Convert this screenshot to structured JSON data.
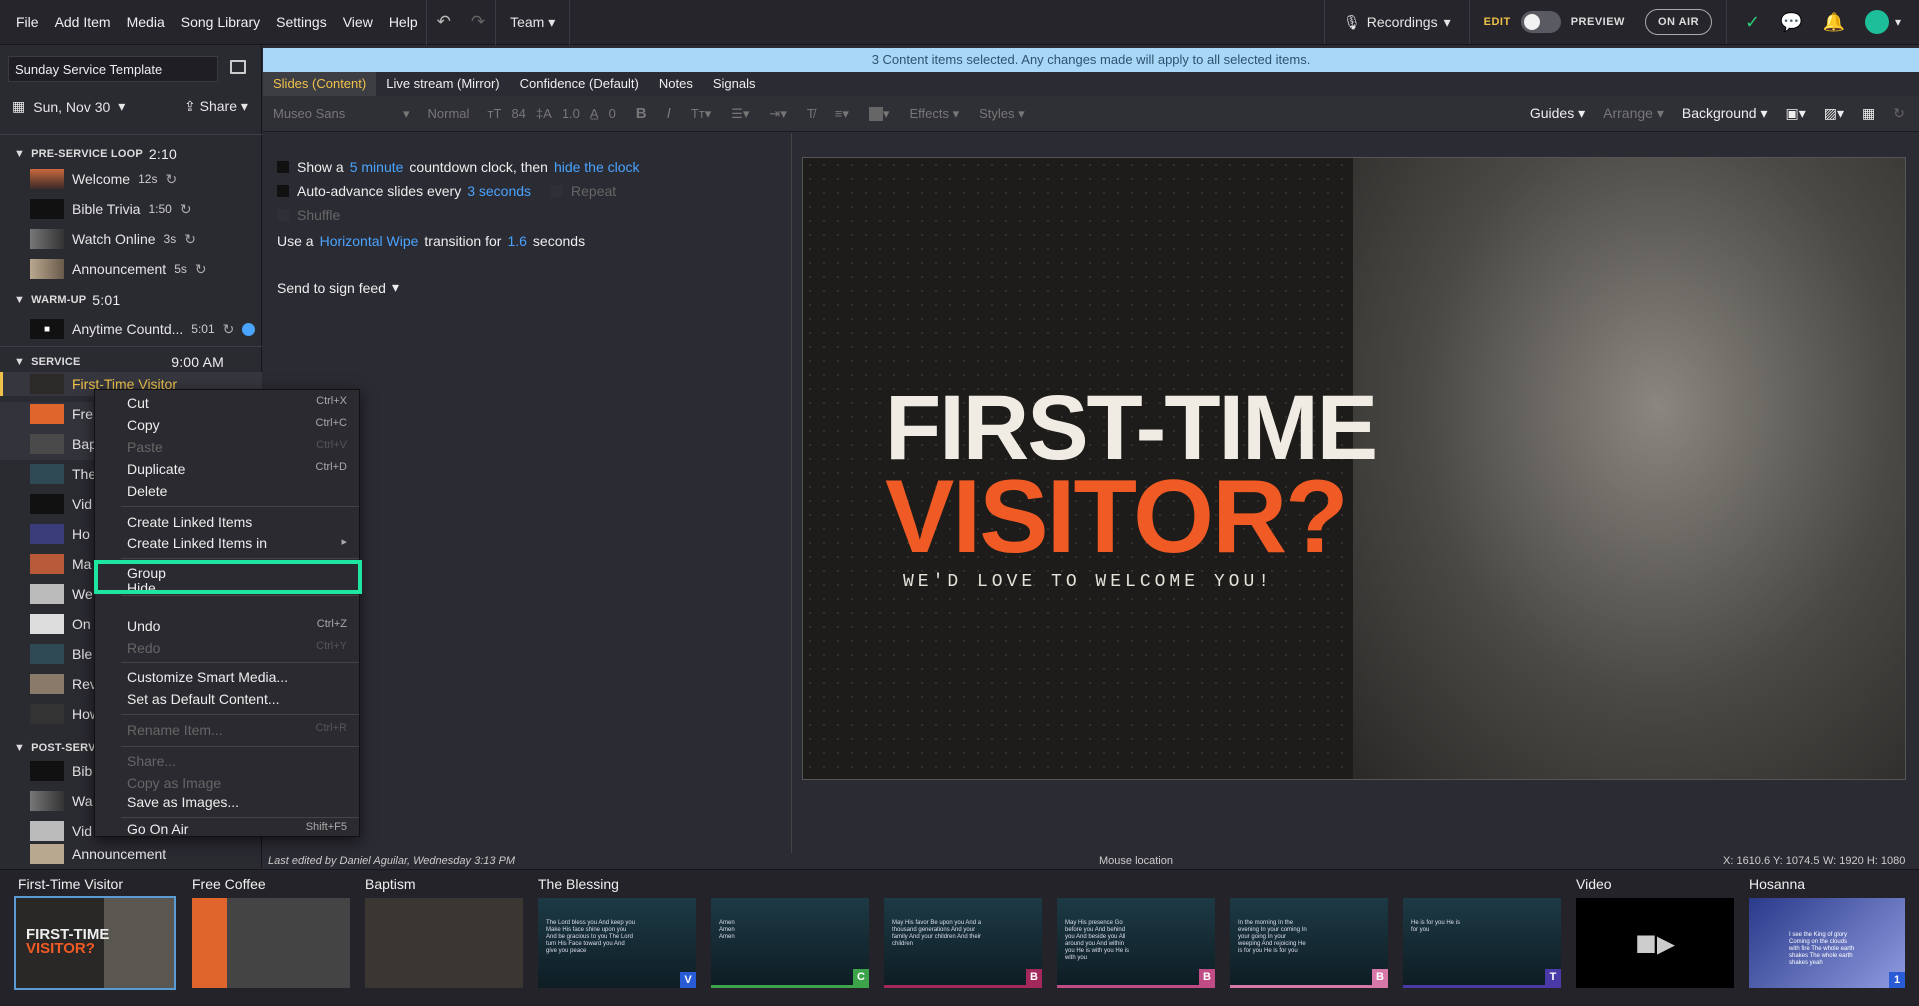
{
  "menu": [
    "File",
    "Add Item",
    "Media",
    "Song Library",
    "Settings",
    "View",
    "Help"
  ],
  "team_label": "Team",
  "recordings_label": "Recordings",
  "edit_label": "EDIT",
  "preview_label": "PREVIEW",
  "on_air_label": "ON AIR",
  "template_name": "Sunday Service Template",
  "date_label": "Sun, Nov 30",
  "share_label": "Share",
  "sections": [
    {
      "name": "PRE-SERVICE LOOP",
      "time": "2:10"
    },
    {
      "name": "WARM-UP",
      "time": "5:01"
    },
    {
      "name": "SERVICE",
      "time": "9:00 AM"
    },
    {
      "name": "POST-SERVI",
      "time": ""
    }
  ],
  "pre_items": [
    {
      "label": "Welcome",
      "dur": "12s"
    },
    {
      "label": "Bible Trivia",
      "dur": "1:50"
    },
    {
      "label": "Watch Online",
      "dur": "3s"
    },
    {
      "label": "Announcement",
      "dur": "5s"
    }
  ],
  "warm_items": [
    {
      "label": "Anytime Countd...",
      "dur": "5:01"
    }
  ],
  "service_items": [
    "First-Time Visitor",
    "Fre",
    "Bap",
    "The",
    "Vid",
    "Ho",
    "Ma",
    "We",
    "On",
    "Ble",
    "Rev",
    "How"
  ],
  "post_items": [
    "Bib",
    "Wa",
    "Vid",
    "Announcement"
  ],
  "context_menu": {
    "cut": "Cut",
    "cut_sc": "Ctrl+X",
    "copy": "Copy",
    "copy_sc": "Ctrl+C",
    "paste": "Paste",
    "paste_sc": "Ctrl+V",
    "duplicate": "Duplicate",
    "duplicate_sc": "Ctrl+D",
    "delete": "Delete",
    "linked": "Create Linked Items",
    "linked_in": "Create Linked Items in",
    "group": "Group",
    "hide": "Hide",
    "undo": "Undo",
    "undo_sc": "Ctrl+Z",
    "redo": "Redo",
    "redo_sc": "Ctrl+Y",
    "customize": "Customize Smart Media...",
    "default": "Set as Default Content...",
    "rename": "Rename Item...",
    "rename_sc": "Ctrl+R",
    "share": "Share...",
    "copy_image": "Copy as Image",
    "save_images": "Save as Images...",
    "go_on_air": "Go On Air",
    "go_on_air_sc": "Shift+F5"
  },
  "banner": "3 Content items selected. Any changes made will apply to all selected items.",
  "tabs": [
    "Slides (Content)",
    "Live stream (Mirror)",
    "Confidence (Default)",
    "Notes",
    "Signals"
  ],
  "toolbar": {
    "font": "Museo Sans",
    "weight": "Normal",
    "size": "84",
    "line": "1.0",
    "spacing": "0",
    "effects": "Effects",
    "styles": "Styles",
    "guides": "Guides",
    "arrange": "Arrange",
    "background": "Background"
  },
  "options": {
    "show_a": "Show a",
    "min": "5 minute",
    "countdown": "countdown clock, then",
    "hide": "hide the clock",
    "auto": "Auto-advance slides every",
    "secs": "3 seconds",
    "repeat": "Repeat",
    "shuffle": "Shuffle",
    "use_a": "Use a",
    "transition": "Horizontal Wipe",
    "trans_for": "transition for",
    "dur": "1.6",
    "seconds": "seconds",
    "send": "Send to sign feed"
  },
  "slide": {
    "line1": "FIRST-TIME",
    "line2": "VISITOR?",
    "sub": "WE'D LOVE TO WELCOME YOU!"
  },
  "status": {
    "edited": "Last edited by Daniel Aguilar, Wednesday 3:13 PM",
    "mouse": "Mouse location",
    "coords": "X: 1610.6  Y: 1074.5",
    "dims": "W: 1920  H: 1080"
  },
  "strip": [
    {
      "title": "First-Time Visitor"
    },
    {
      "title": "Free Coffee"
    },
    {
      "title": "Baptism"
    },
    {
      "title": "The Blessing"
    },
    {
      "title": "Video"
    },
    {
      "title": "Hosanna"
    }
  ],
  "blessing_lyrics": [
    "The Lord bless you And keep you Make His face shine upon you And be gracious to you The Lord turn His Face toward you And give you peace",
    "Amen Amen Amen",
    "May His favor Be upon you And a thousand generations And your family And your children And their children",
    "May His presence Go before you And behind you And beside you All around you And within you He is with you He is with you",
    "In the morning In the evening In your coming In your going In your weeping And rejoicing He is for you He is for you",
    "He is for you He is for you"
  ],
  "blessing_labels": [
    "V",
    "C",
    "B",
    "B",
    "B",
    "T"
  ],
  "blessing_colors": [
    "#2a5bd7",
    "#3da34b",
    "#a3285c",
    "#c04c86",
    "#d679a9",
    "#4a3aa8"
  ],
  "hosanna_label": "1",
  "hosanna_lyrics": "I see the King of glory Coming on the clouds with fire The whole earth shakes The whole earth shakes yeah"
}
